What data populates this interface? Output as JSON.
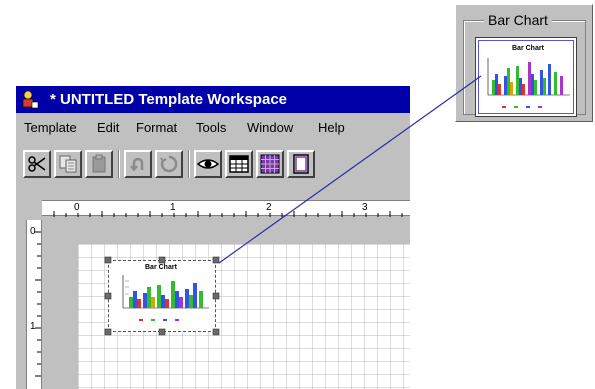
{
  "window": {
    "title": "* UNTITLED Template Workspace",
    "menus": [
      "Template",
      "Edit",
      "Format",
      "Tools",
      "Window",
      "Help"
    ]
  },
  "toolbar": {
    "buttons": [
      "scissors-icon",
      "copy-icon",
      "paste-icon",
      "undo-icon",
      "redo-icon",
      "eye-icon",
      "table-grid-icon",
      "color-grid-icon",
      "page-icon"
    ]
  },
  "rulers": {
    "horizontal_labels": [
      "0",
      "1",
      "2",
      "3"
    ],
    "vertical_labels": [
      "0",
      "1"
    ]
  },
  "embedded_chart": {
    "title": "Bar Chart",
    "bar_colors": [
      "#3355dd",
      "#33bb33",
      "#dd3333",
      "#ccaa00",
      "#aa33cc",
      "#33aacc"
    ]
  },
  "preview": {
    "label": "Bar Chart",
    "title": "Bar Chart"
  },
  "colors": {
    "titlebar": "#0000a8",
    "chrome": "#c0c0c0",
    "grid": "#b8b8b8",
    "connector": "#2c2ca8"
  }
}
